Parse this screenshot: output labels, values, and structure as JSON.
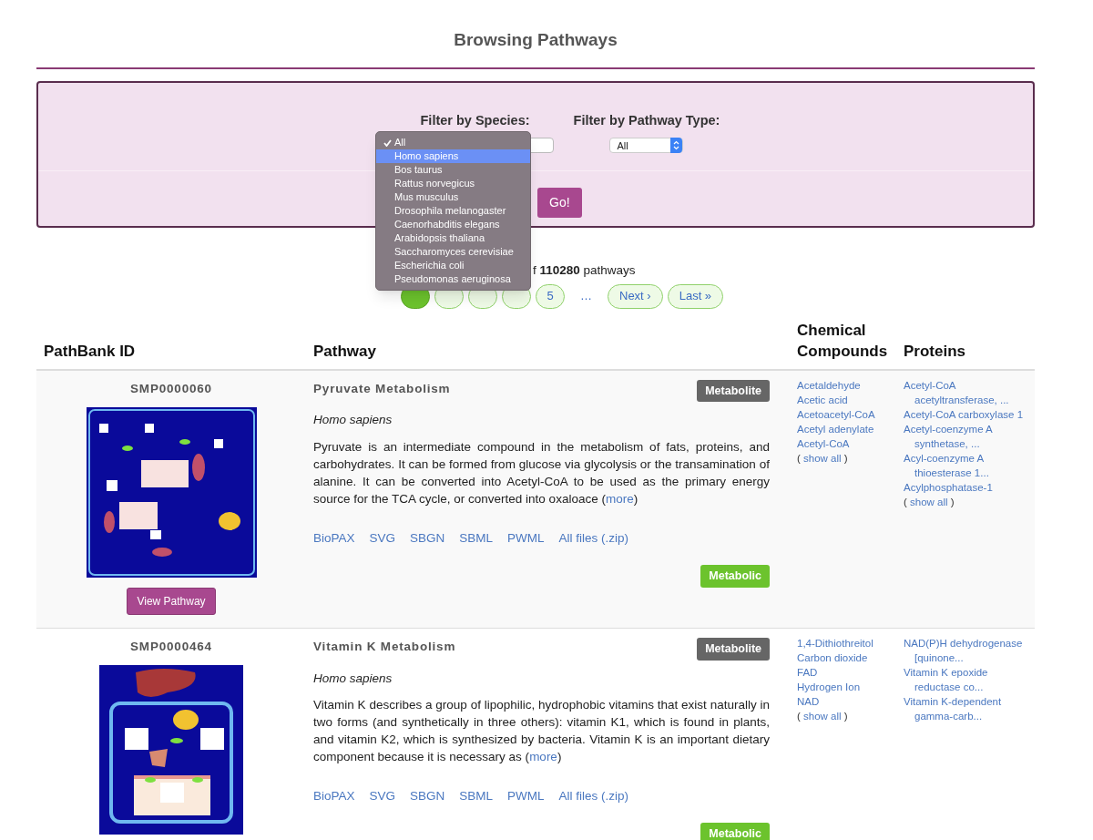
{
  "page_title": "Browsing Pathways",
  "filters": {
    "species_label": "Filter by Species:",
    "type_label": "Filter by Pathway Type:",
    "type_value": "All",
    "go_button": "Go!",
    "species_menu": [
      {
        "label": "All",
        "selected": true,
        "highlighted": false
      },
      {
        "label": "Homo sapiens",
        "selected": false,
        "highlighted": true
      },
      {
        "label": "Bos taurus",
        "selected": false,
        "highlighted": false
      },
      {
        "label": "Rattus norvegicus",
        "selected": false,
        "highlighted": false
      },
      {
        "label": "Mus musculus",
        "selected": false,
        "highlighted": false
      },
      {
        "label": "Drosophila melanogaster",
        "selected": false,
        "highlighted": false
      },
      {
        "label": "Caenorhabditis elegans",
        "selected": false,
        "highlighted": false
      },
      {
        "label": "Arabidopsis thaliana",
        "selected": false,
        "highlighted": false
      },
      {
        "label": "Saccharomyces cerevisiae",
        "selected": false,
        "highlighted": false
      },
      {
        "label": "Escherichia coli",
        "selected": false,
        "highlighted": false
      },
      {
        "label": "Pseudomonas aeruginosa",
        "selected": false,
        "highlighted": false
      }
    ]
  },
  "results_count": "f **110280** pathways",
  "pagination": {
    "pages": [
      {
        "selected": true
      },
      {
        "selected": false
      },
      {
        "selected": false
      },
      {
        "selected": false
      },
      {
        "label": "5",
        "selected": false
      }
    ],
    "ellipsis": "…",
    "next": "Next ›",
    "last": "Last »"
  },
  "table": {
    "columns": [
      "PathBank ID",
      "Pathway",
      "Chemical Compounds",
      "Proteins"
    ],
    "rows": [
      {
        "id": "SMP0000060",
        "view_button": "View Pathway",
        "title": "Pyruvate Metabolism",
        "category": "Metabolite",
        "species": "Homo sapiens",
        "description": "Pyruvate is an intermediate compound in the metabolism of fats, proteins, and carbohydrates. It can be formed from glucose via glycolysis or the transamination of alanine. It can be converted into Acetyl-CoA to be used as the primary energy source for the TCA cycle, or converted into oxaloace (",
        "more_link": "more",
        "description_end": ")",
        "downloads": [
          "BioPAX",
          "SVG",
          "SBGN",
          "SBML",
          "PWML",
          "All files (.zip)"
        ],
        "type": "Metabolic",
        "compounds": [
          "Acetaldehyde",
          "Acetic acid",
          "Acetoacetyl-CoA",
          "Acetyl adenylate",
          "Acetyl-CoA"
        ],
        "compounds_show_all": {
          "open": "(",
          "link": "show all",
          "close": ")"
        },
        "proteins": [
          "Acetyl-CoA acetyltransferase, ...",
          "Acetyl-CoA carboxylase 1",
          "Acetyl-coenzyme A synthetase, ...",
          "Acyl-coenzyme A thioesterase 1...",
          "Acylphosphatase-1"
        ],
        "proteins_show_all": {
          "open": "(",
          "link": "show all",
          "close": ")"
        }
      },
      {
        "id": "SMP0000464",
        "title": "Vitamin K Metabolism",
        "category": "Metabolite",
        "species": "Homo sapiens",
        "description": "Vitamin K describes a group of lipophilic, hydrophobic vitamins that exist naturally in two forms (and synthetically in three others): vitamin K1, which is found in plants, and vitamin K2, which is synthesized by bacteria. Vitamin K is an important dietary component because it is necessary as (",
        "more_link": "more",
        "description_end": ")",
        "downloads": [
          "BioPAX",
          "SVG",
          "SBGN",
          "SBML",
          "PWML",
          "All files (.zip)"
        ],
        "type": "Metabolic",
        "compounds": [
          "1,4-Dithiothreitol",
          "Carbon dioxide",
          "FAD",
          "Hydrogen Ion",
          "NAD"
        ],
        "compounds_show_all": {
          "open": "(",
          "link": "show all",
          "close": ")"
        },
        "proteins": [
          "NAD(P)H dehydrogenase [quinone...",
          "Vitamin K epoxide reductase co...",
          "Vitamin K-dependent gamma-carb..."
        ]
      }
    ]
  }
}
